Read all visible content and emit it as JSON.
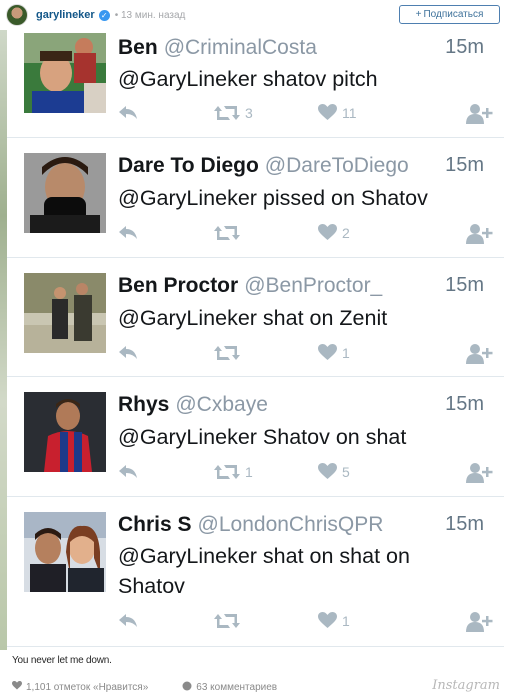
{
  "ig_header": {
    "username": "garylineker",
    "time": "13 мин. назад",
    "follow_label": "Подписаться"
  },
  "tweets": [
    {
      "name": "Ben",
      "handle": "@CriminalCosta",
      "time": "15m",
      "text": "@GaryLineker shatov pitch",
      "retweets": "3",
      "likes": "11"
    },
    {
      "name": "Dare To Diego",
      "handle": "@DareToDiego",
      "time": "15m",
      "text": "@GaryLineker pissed on Shatov",
      "retweets": "",
      "likes": "2"
    },
    {
      "name": "Ben Proctor",
      "handle": "@BenProctor_",
      "time": "15m",
      "text": "@GaryLineker shat on Zenit",
      "retweets": "",
      "likes": "1"
    },
    {
      "name": "Rhys",
      "handle": "@Cxbaye",
      "time": "15m",
      "text": "@GaryLineker Shatov on shat",
      "retweets": "1",
      "likes": "5"
    },
    {
      "name": "Chris S",
      "handle": "@LondonChrisQPR",
      "time": "15m",
      "text_line1": "@GaryLineker shat on shat on",
      "text_line2": "Shatov",
      "retweets": "",
      "likes": "1"
    }
  ],
  "caption": "You never let me down.",
  "footer": {
    "likes_text": "1,101 отметок «Нравится»",
    "comments_text": "63 комментариев",
    "brand": "Instagram"
  },
  "colors": {
    "twitter_icon": "#aab8c2",
    "handle": "#8b98a5",
    "ig_link": "#125688",
    "verified": "#3897f0"
  }
}
